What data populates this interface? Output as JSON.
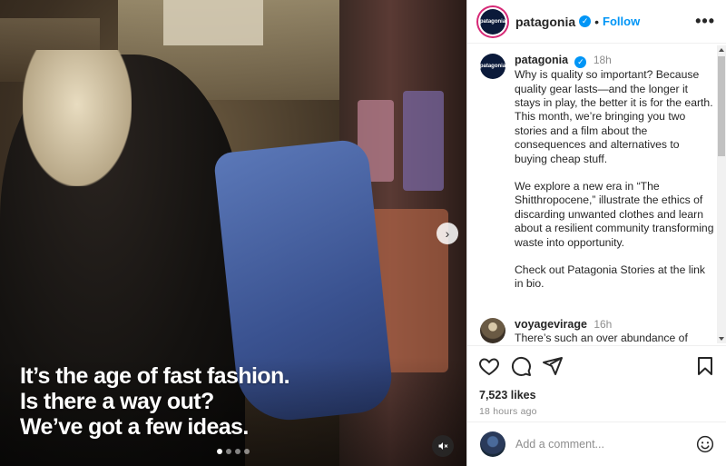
{
  "post": {
    "caption_lines": [
      "It’s the age of fast fashion.",
      "Is there a way out?",
      "We’ve got a few ideas."
    ],
    "carousel_count": 4,
    "carousel_active": 1
  },
  "header": {
    "username": "patagonia",
    "avatar_text": "patagonia",
    "separator": "•",
    "follow_label": "Follow",
    "more_label": "•••"
  },
  "comments": [
    {
      "username": "patagonia",
      "time": "18h",
      "paragraphs": [
        "Why is quality so important? Because quality gear lasts—and the longer it stays in play, the better it is for the earth. This month, we’re bringing you two stories and a film about the consequences and alternatives to buying cheap stuff.",
        "We explore a new era in “The Shitthropocene,” illustrate the ethics of discarding unwanted clothes and learn about a resilient community transforming waste into opportunity.",
        "Check out Patagonia Stories at the link in bio."
      ]
    },
    {
      "username": "voyagevirage",
      "time": "16h",
      "text": "There’s such an over abundance of"
    }
  ],
  "stats": {
    "likes": "7,523 likes",
    "posted": "18 hours ago"
  },
  "add_comment": {
    "placeholder": "Add a comment..."
  },
  "icons": [
    "heart-icon",
    "comment-icon",
    "share-icon",
    "bookmark-icon",
    "emoji-icon",
    "mute-icon",
    "chevron-right-icon",
    "verified-icon"
  ],
  "colors": {
    "accent": "#0095f6",
    "text": "#262626",
    "muted": "#8e8e8e"
  }
}
